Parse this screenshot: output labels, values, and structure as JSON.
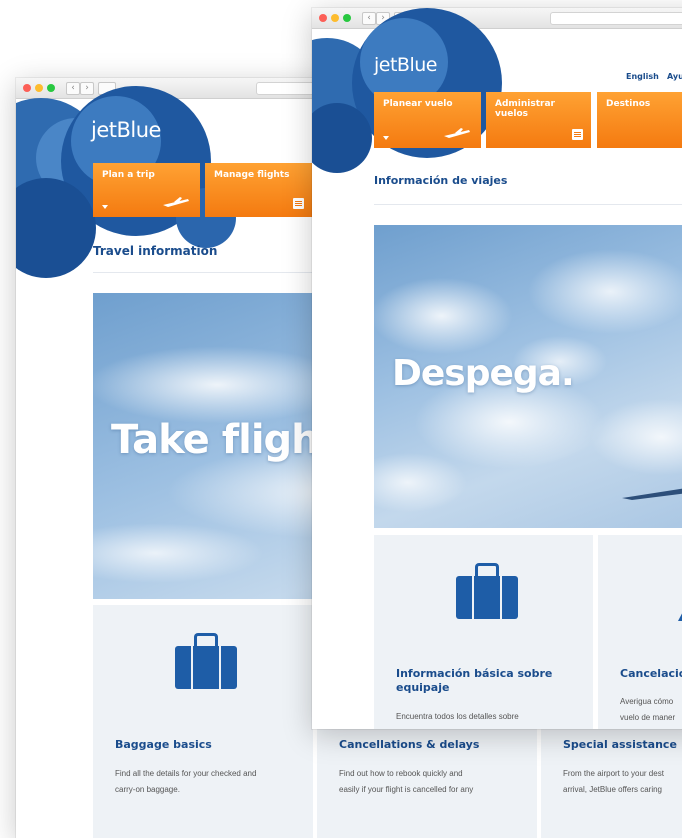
{
  "english_window": {
    "logo": "jetBlue",
    "nav": [
      {
        "label": "Plan a trip"
      },
      {
        "label": "Manage flights"
      }
    ],
    "section_title": "Travel information",
    "hero_text": "Take flight.",
    "cards": [
      {
        "title": "Baggage basics",
        "line1": "Find all the details for your checked and",
        "line2": "carry-on baggage."
      },
      {
        "title": "Cancellations & delays",
        "line1": "Find out how to rebook quickly and",
        "line2": "easily if your flight is cancelled for any"
      },
      {
        "title": "Special assistance",
        "line1": "From the airport to your dest",
        "line2": "arrival, JetBlue offers caring"
      }
    ]
  },
  "spanish_window": {
    "logo": "jetBlue",
    "top_links": {
      "english": "English",
      "help": "Ayu"
    },
    "nav": [
      {
        "label": "Planear vuelo"
      },
      {
        "label": "Administrar vuelos"
      },
      {
        "label": "Destinos"
      }
    ],
    "section_title": "Información de viajes",
    "hero_text": "Despega.",
    "cards": [
      {
        "title_line1": "Información básica sobre",
        "title_line2": "equipaje",
        "line1": "Encuentra todos los detalles sobre"
      },
      {
        "title_line1": "Cancelacion",
        "line1": "Averigua cómo",
        "line2": "vuelo de maner"
      }
    ]
  },
  "colors": {
    "brand_blue": "#1a4c8c",
    "accent_orange": "#f47a10",
    "card_bg": "#eef2f6"
  }
}
